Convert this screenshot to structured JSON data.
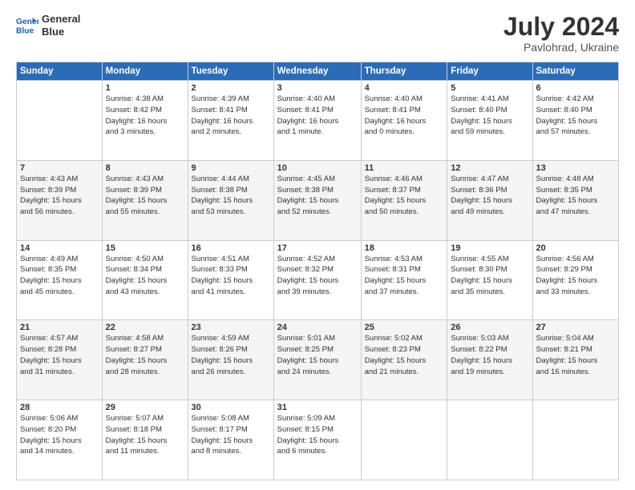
{
  "logo": {
    "line1": "General",
    "line2": "Blue"
  },
  "title": {
    "month_year": "July 2024",
    "location": "Pavlohrad, Ukraine"
  },
  "header_days": [
    "Sunday",
    "Monday",
    "Tuesday",
    "Wednesday",
    "Thursday",
    "Friday",
    "Saturday"
  ],
  "weeks": [
    [
      {
        "day": "",
        "info": ""
      },
      {
        "day": "1",
        "info": "Sunrise: 4:38 AM\nSunset: 8:42 PM\nDaylight: 16 hours\nand 3 minutes."
      },
      {
        "day": "2",
        "info": "Sunrise: 4:39 AM\nSunset: 8:41 PM\nDaylight: 16 hours\nand 2 minutes."
      },
      {
        "day": "3",
        "info": "Sunrise: 4:40 AM\nSunset: 8:41 PM\nDaylight: 16 hours\nand 1 minute."
      },
      {
        "day": "4",
        "info": "Sunrise: 4:40 AM\nSunset: 8:41 PM\nDaylight: 16 hours\nand 0 minutes."
      },
      {
        "day": "5",
        "info": "Sunrise: 4:41 AM\nSunset: 8:40 PM\nDaylight: 15 hours\nand 59 minutes."
      },
      {
        "day": "6",
        "info": "Sunrise: 4:42 AM\nSunset: 8:40 PM\nDaylight: 15 hours\nand 57 minutes."
      }
    ],
    [
      {
        "day": "7",
        "info": "Sunrise: 4:43 AM\nSunset: 8:39 PM\nDaylight: 15 hours\nand 56 minutes."
      },
      {
        "day": "8",
        "info": "Sunrise: 4:43 AM\nSunset: 8:39 PM\nDaylight: 15 hours\nand 55 minutes."
      },
      {
        "day": "9",
        "info": "Sunrise: 4:44 AM\nSunset: 8:38 PM\nDaylight: 15 hours\nand 53 minutes."
      },
      {
        "day": "10",
        "info": "Sunrise: 4:45 AM\nSunset: 8:38 PM\nDaylight: 15 hours\nand 52 minutes."
      },
      {
        "day": "11",
        "info": "Sunrise: 4:46 AM\nSunset: 8:37 PM\nDaylight: 15 hours\nand 50 minutes."
      },
      {
        "day": "12",
        "info": "Sunrise: 4:47 AM\nSunset: 8:36 PM\nDaylight: 15 hours\nand 49 minutes."
      },
      {
        "day": "13",
        "info": "Sunrise: 4:48 AM\nSunset: 8:35 PM\nDaylight: 15 hours\nand 47 minutes."
      }
    ],
    [
      {
        "day": "14",
        "info": "Sunrise: 4:49 AM\nSunset: 8:35 PM\nDaylight: 15 hours\nand 45 minutes."
      },
      {
        "day": "15",
        "info": "Sunrise: 4:50 AM\nSunset: 8:34 PM\nDaylight: 15 hours\nand 43 minutes."
      },
      {
        "day": "16",
        "info": "Sunrise: 4:51 AM\nSunset: 8:33 PM\nDaylight: 15 hours\nand 41 minutes."
      },
      {
        "day": "17",
        "info": "Sunrise: 4:52 AM\nSunset: 8:32 PM\nDaylight: 15 hours\nand 39 minutes."
      },
      {
        "day": "18",
        "info": "Sunrise: 4:53 AM\nSunset: 8:31 PM\nDaylight: 15 hours\nand 37 minutes."
      },
      {
        "day": "19",
        "info": "Sunrise: 4:55 AM\nSunset: 8:30 PM\nDaylight: 15 hours\nand 35 minutes."
      },
      {
        "day": "20",
        "info": "Sunrise: 4:56 AM\nSunset: 8:29 PM\nDaylight: 15 hours\nand 33 minutes."
      }
    ],
    [
      {
        "day": "21",
        "info": "Sunrise: 4:57 AM\nSunset: 8:28 PM\nDaylight: 15 hours\nand 31 minutes."
      },
      {
        "day": "22",
        "info": "Sunrise: 4:58 AM\nSunset: 8:27 PM\nDaylight: 15 hours\nand 28 minutes."
      },
      {
        "day": "23",
        "info": "Sunrise: 4:59 AM\nSunset: 8:26 PM\nDaylight: 15 hours\nand 26 minutes."
      },
      {
        "day": "24",
        "info": "Sunrise: 5:01 AM\nSunset: 8:25 PM\nDaylight: 15 hours\nand 24 minutes."
      },
      {
        "day": "25",
        "info": "Sunrise: 5:02 AM\nSunset: 8:23 PM\nDaylight: 15 hours\nand 21 minutes."
      },
      {
        "day": "26",
        "info": "Sunrise: 5:03 AM\nSunset: 8:22 PM\nDaylight: 15 hours\nand 19 minutes."
      },
      {
        "day": "27",
        "info": "Sunrise: 5:04 AM\nSunset: 8:21 PM\nDaylight: 15 hours\nand 16 minutes."
      }
    ],
    [
      {
        "day": "28",
        "info": "Sunrise: 5:06 AM\nSunset: 8:20 PM\nDaylight: 15 hours\nand 14 minutes."
      },
      {
        "day": "29",
        "info": "Sunrise: 5:07 AM\nSunset: 8:18 PM\nDaylight: 15 hours\nand 11 minutes."
      },
      {
        "day": "30",
        "info": "Sunrise: 5:08 AM\nSunset: 8:17 PM\nDaylight: 15 hours\nand 8 minutes."
      },
      {
        "day": "31",
        "info": "Sunrise: 5:09 AM\nSunset: 8:15 PM\nDaylight: 15 hours\nand 6 minutes."
      },
      {
        "day": "",
        "info": ""
      },
      {
        "day": "",
        "info": ""
      },
      {
        "day": "",
        "info": ""
      }
    ]
  ]
}
